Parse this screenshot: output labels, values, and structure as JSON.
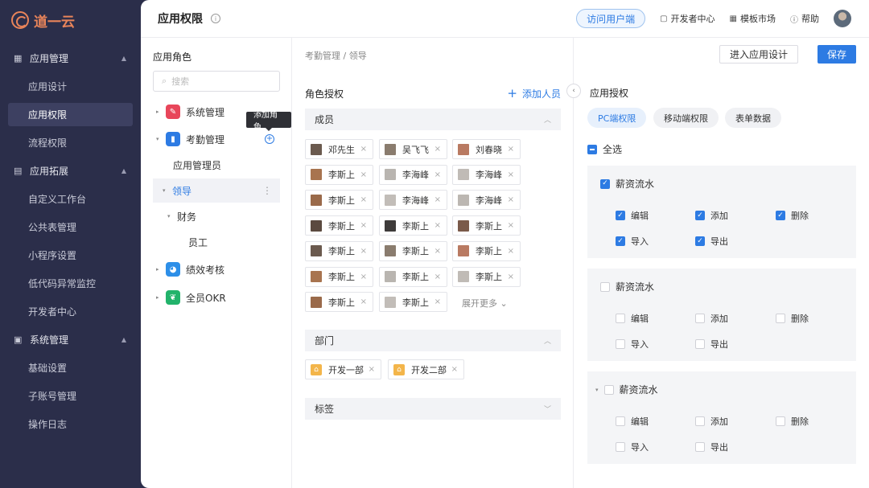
{
  "app": {
    "logo_text": "道一云"
  },
  "sidebar": {
    "groups": [
      {
        "label": "应用管理",
        "icon": "grid-icon",
        "items": [
          "应用设计",
          "应用权限",
          "流程权限"
        ]
      },
      {
        "label": "应用拓展",
        "icon": "document-icon",
        "items": [
          "自定义工作台",
          "公共表管理",
          "小程序设置",
          "低代码异常监控",
          "开发者中心"
        ]
      },
      {
        "label": "系统管理",
        "icon": "calendar-icon",
        "items": [
          "基础设置",
          "子账号管理",
          "操作日志"
        ]
      }
    ],
    "active_item": "应用权限"
  },
  "header": {
    "title": "应用权限",
    "visit_label": "访问用户端",
    "links": [
      {
        "label": "开发者中心",
        "icon": "terminal-icon"
      },
      {
        "label": "模板市场",
        "icon": "grid-icon"
      },
      {
        "label": "帮助",
        "icon": "help-icon"
      }
    ]
  },
  "roles": {
    "title": "应用角色",
    "search_placeholder": "搜索",
    "tooltip": "添加角色",
    "tree": [
      {
        "label": "系统管理",
        "color": "#e8465a"
      },
      {
        "label": "考勤管理",
        "color": "#2d7be3"
      },
      {
        "label": "应用管理员"
      },
      {
        "label": "领导"
      },
      {
        "label": "财务"
      },
      {
        "label": "员工"
      },
      {
        "label": "绩效考核",
        "color": "#2d8fe8"
      },
      {
        "label": "全员OKR",
        "color": "#22b36b"
      }
    ]
  },
  "authorization": {
    "breadcrumb": "考勤管理 / 领导",
    "title": "角色授权",
    "add_member": "添加人员",
    "members_label": "成员",
    "members": [
      "邓先生",
      "吴飞飞",
      "刘春晓",
      "李斯上",
      "李海峰",
      "李海峰",
      "李斯上",
      "李海峰",
      "李海峰",
      "李斯上",
      "李斯上",
      "李斯上",
      "李斯上",
      "李斯上",
      "李斯上",
      "李斯上",
      "李斯上",
      "李斯上",
      "李斯上",
      "李斯上"
    ],
    "more_label": "展开更多",
    "dept_label": "部门",
    "departments": [
      "开发一部",
      "开发二部"
    ],
    "tags_label": "标签"
  },
  "app_perm": {
    "enter_design": "进入应用设计",
    "save": "保存",
    "title": "应用授权",
    "tabs": [
      "PC端权限",
      "移动端权限",
      "表单数据"
    ],
    "select_all": "全选",
    "groups": [
      {
        "name": "薪资流水",
        "checked": true,
        "perms": [
          {
            "label": "编辑",
            "on": true
          },
          {
            "label": "添加",
            "on": true
          },
          {
            "label": "删除",
            "on": true
          },
          {
            "label": "导入",
            "on": true
          },
          {
            "label": "导出",
            "on": true
          }
        ]
      },
      {
        "name": "薪资流水",
        "checked": false,
        "perms": [
          {
            "label": "编辑",
            "on": false
          },
          {
            "label": "添加",
            "on": false
          },
          {
            "label": "删除",
            "on": false
          },
          {
            "label": "导入",
            "on": false
          },
          {
            "label": "导出",
            "on": false
          }
        ]
      },
      {
        "name": "薪资流水",
        "checked": false,
        "perms": [
          {
            "label": "编辑",
            "on": false
          },
          {
            "label": "添加",
            "on": false
          },
          {
            "label": "删除",
            "on": false
          },
          {
            "label": "导入",
            "on": false
          },
          {
            "label": "导出",
            "on": false
          }
        ]
      }
    ]
  }
}
